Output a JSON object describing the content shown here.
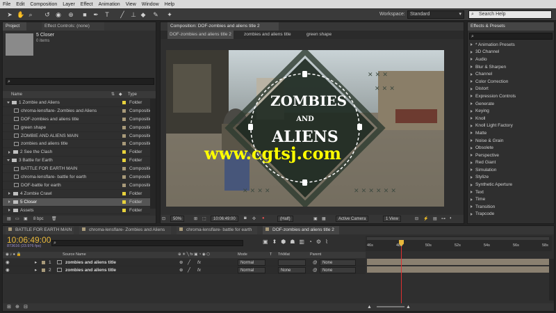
{
  "menu": [
    "File",
    "Edit",
    "Composition",
    "Layer",
    "Effect",
    "Animation",
    "View",
    "Window",
    "Help"
  ],
  "toolbar": {
    "tools": [
      "selection-tool-icon",
      "hand-tool-icon",
      "zoom-tool-icon",
      "rotate-tool-icon",
      "camera-tool-icon",
      "pan-behind-tool-icon",
      "rectangle-tool-icon",
      "pen-tool-icon",
      "type-tool-icon",
      "brush-tool-icon",
      "clone-stamp-tool-icon",
      "eraser-tool-icon",
      "roto-brush-tool-icon",
      "puppet-tool-icon"
    ],
    "workspace_label": "Workspace:",
    "workspace_value": "Standard",
    "search_placeholder": "Search Help"
  },
  "project": {
    "tab_project": "Project",
    "tab_effect_controls": "Effect Controls: (none)",
    "selected_name": "5 Closer",
    "selected_info": "0 items",
    "col_name": "Name",
    "col_type": "Type",
    "items": [
      {
        "indent": 0,
        "icon": "folder",
        "expanded": true,
        "name": "1 Zombie and Aliens",
        "color": "#e8d23c",
        "type": "Folder"
      },
      {
        "indent": 1,
        "icon": "comp",
        "name": "chroma-lensflare- Zombies and Aliens",
        "color": "#a89a7a",
        "type": "Composition"
      },
      {
        "indent": 1,
        "icon": "comp",
        "name": "DOF-zombies and aliens title",
        "color": "#a89a7a",
        "type": "Composition"
      },
      {
        "indent": 1,
        "icon": "comp",
        "name": "green shape",
        "color": "#a89a7a",
        "type": "Composition"
      },
      {
        "indent": 1,
        "icon": "comp",
        "name": "ZOMBIE AND ALIENS MAIN",
        "color": "#a89a7a",
        "type": "Composition"
      },
      {
        "indent": 1,
        "icon": "comp",
        "name": "zombies and aliens title",
        "color": "#a89a7a",
        "type": "Composition"
      },
      {
        "indent": 0,
        "icon": "folder",
        "expanded": false,
        "name": "2 See the Clash",
        "color": "#e8d23c",
        "type": "Folder"
      },
      {
        "indent": 0,
        "icon": "folder",
        "expanded": true,
        "name": "3 Battle for Earth",
        "color": "#e8d23c",
        "type": "Folder"
      },
      {
        "indent": 1,
        "icon": "comp",
        "name": "BATTLE FOR EARTH MAIN",
        "color": "#a89a7a",
        "type": "Composition"
      },
      {
        "indent": 1,
        "icon": "comp",
        "name": "chroma-lensflare- battle for earth",
        "color": "#a89a7a",
        "type": "Composition"
      },
      {
        "indent": 1,
        "icon": "comp",
        "name": "DOF-battle for earth",
        "color": "#a89a7a",
        "type": "Composition"
      },
      {
        "indent": 0,
        "icon": "folder",
        "expanded": false,
        "name": "4 Zombie Crawl",
        "color": "#e8d23c",
        "type": "Folder"
      },
      {
        "indent": 0,
        "icon": "folder",
        "expanded": false,
        "name": "5 Closer",
        "color": "#e8d23c",
        "type": "Folder",
        "selected": true
      },
      {
        "indent": 0,
        "icon": "folder",
        "expanded": false,
        "name": "Assets",
        "color": "#e8d23c",
        "type": "Folder"
      }
    ],
    "bpc": "8 bpc"
  },
  "composition": {
    "tab_title": "Composition: DOF-zombies and aliens title 2",
    "breadcrumbs": [
      "DOF-zombies and aliens title 2",
      "zombies and aliens title",
      "green shape"
    ],
    "title_lines": [
      "ZOMBIES",
      "AND",
      "ALIENS"
    ],
    "watermark": "www.cgtsj.com",
    "zoom": "50%",
    "timecode": "10:06:49:00",
    "resolution": "(Half)",
    "camera": "Active Camera",
    "view": "1 View"
  },
  "effects": {
    "title": "Effects & Presets",
    "items": [
      "* Animation Presets",
      "3D Channel",
      "Audio",
      "Blur & Sharpen",
      "Channel",
      "Color Correction",
      "Distort",
      "Expression Controls",
      "Generate",
      "Keying",
      "Knoll",
      "Knoll Light Factory",
      "Matte",
      "Noise & Grain",
      "Obsolete",
      "Perspective",
      "Red Giant",
      "Simulation",
      "Stylize",
      "Synthetic Aperture",
      "Text",
      "Time",
      "Transition",
      "Trapcode"
    ]
  },
  "timeline": {
    "tabs": [
      "BATTLE FOR EARTH MAIN",
      "chroma-lensflare- Zombies and Aliens",
      "chroma-lensflare- battle for earth",
      "DOF-zombies and aliens title 2"
    ],
    "timecode": "10:06:49:00",
    "frame_info": "873616 (23.976 fps)",
    "col_source": "Source Name",
    "col_mode": "Mode",
    "col_t": "T",
    "col_trkmat": "TrkMat",
    "col_parent": "Parent",
    "ruler_labels": [
      "46s",
      "48s",
      "50s",
      "52s",
      "54s",
      "56s",
      "58s"
    ],
    "layers": [
      {
        "num": "1",
        "name": "zombies and aliens title",
        "mode": "Normal",
        "trkmat": "",
        "parent": "None"
      },
      {
        "num": "2",
        "name": "zombies and aliens title",
        "mode": "Normal",
        "trkmat": "None",
        "parent": "None"
      }
    ],
    "toggle_label": "Toggle Switches / Modes"
  }
}
